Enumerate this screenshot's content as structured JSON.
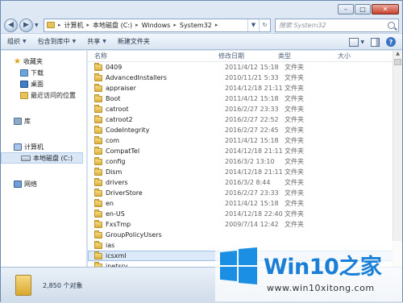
{
  "address": {
    "crumbs": [
      "计算机",
      "本地磁盘 (C:)",
      "Windows",
      "System32"
    ]
  },
  "search": {
    "placeholder": "搜索 System32"
  },
  "toolbar": {
    "organize": "组织",
    "include_in_library": "包含到库中",
    "share": "共享",
    "new_folder": "新建文件夹"
  },
  "nav": {
    "favorites": "收藏夹",
    "downloads": "下载",
    "desktop": "桌面",
    "recent": "最近访问的位置",
    "libraries": "库",
    "computer": "计算机",
    "local_disk": "本地磁盘 (C:)",
    "network": "网络"
  },
  "columns": {
    "name": "名称",
    "date": "修改日期",
    "type": "类型",
    "size": "大小"
  },
  "files": [
    {
      "name": "0409",
      "date": "2011/4/12 15:18",
      "type": "文件夹"
    },
    {
      "name": "AdvancedInstallers",
      "date": "2010/11/21 5:33",
      "type": "文件夹"
    },
    {
      "name": "appraiser",
      "date": "2014/12/18 21:11",
      "type": "文件夹"
    },
    {
      "name": "Boot",
      "date": "2011/4/12 15:18",
      "type": "文件夹"
    },
    {
      "name": "catroot",
      "date": "2016/2/27 23:33",
      "type": "文件夹"
    },
    {
      "name": "catroot2",
      "date": "2016/2/27 22:52",
      "type": "文件夹"
    },
    {
      "name": "CodeIntegrity",
      "date": "2016/2/27 22:45",
      "type": "文件夹"
    },
    {
      "name": "com",
      "date": "2011/4/12 15:18",
      "type": "文件夹"
    },
    {
      "name": "CompatTel",
      "date": "2014/12/18 21:11",
      "type": "文件夹"
    },
    {
      "name": "config",
      "date": "2016/3/2 13:10",
      "type": "文件夹"
    },
    {
      "name": "Dism",
      "date": "2014/12/18 21:11",
      "type": "文件夹"
    },
    {
      "name": "drivers",
      "date": "2016/3/2 8:44",
      "type": "文件夹"
    },
    {
      "name": "DriverStore",
      "date": "2016/2/27 23:33",
      "type": "文件夹"
    },
    {
      "name": "en",
      "date": "2011/4/12 15:18",
      "type": "文件夹"
    },
    {
      "name": "en-US",
      "date": "2014/12/18 22:40",
      "type": "文件夹"
    },
    {
      "name": "FxsTmp",
      "date": "2009/7/14 12:42",
      "type": "文件夹"
    },
    {
      "name": "GroupPolicyUsers",
      "date": "",
      "type": ""
    },
    {
      "name": "ias",
      "date": "",
      "type": ""
    },
    {
      "name": "icsxml",
      "date": "",
      "type": ""
    },
    {
      "name": "inetsrv",
      "date": "",
      "type": ""
    }
  ],
  "status": {
    "count": "2,850 个对象"
  },
  "watermark": {
    "brand": "Win10",
    "brand_cn": "之家",
    "url": "www.win10xitong.com"
  }
}
